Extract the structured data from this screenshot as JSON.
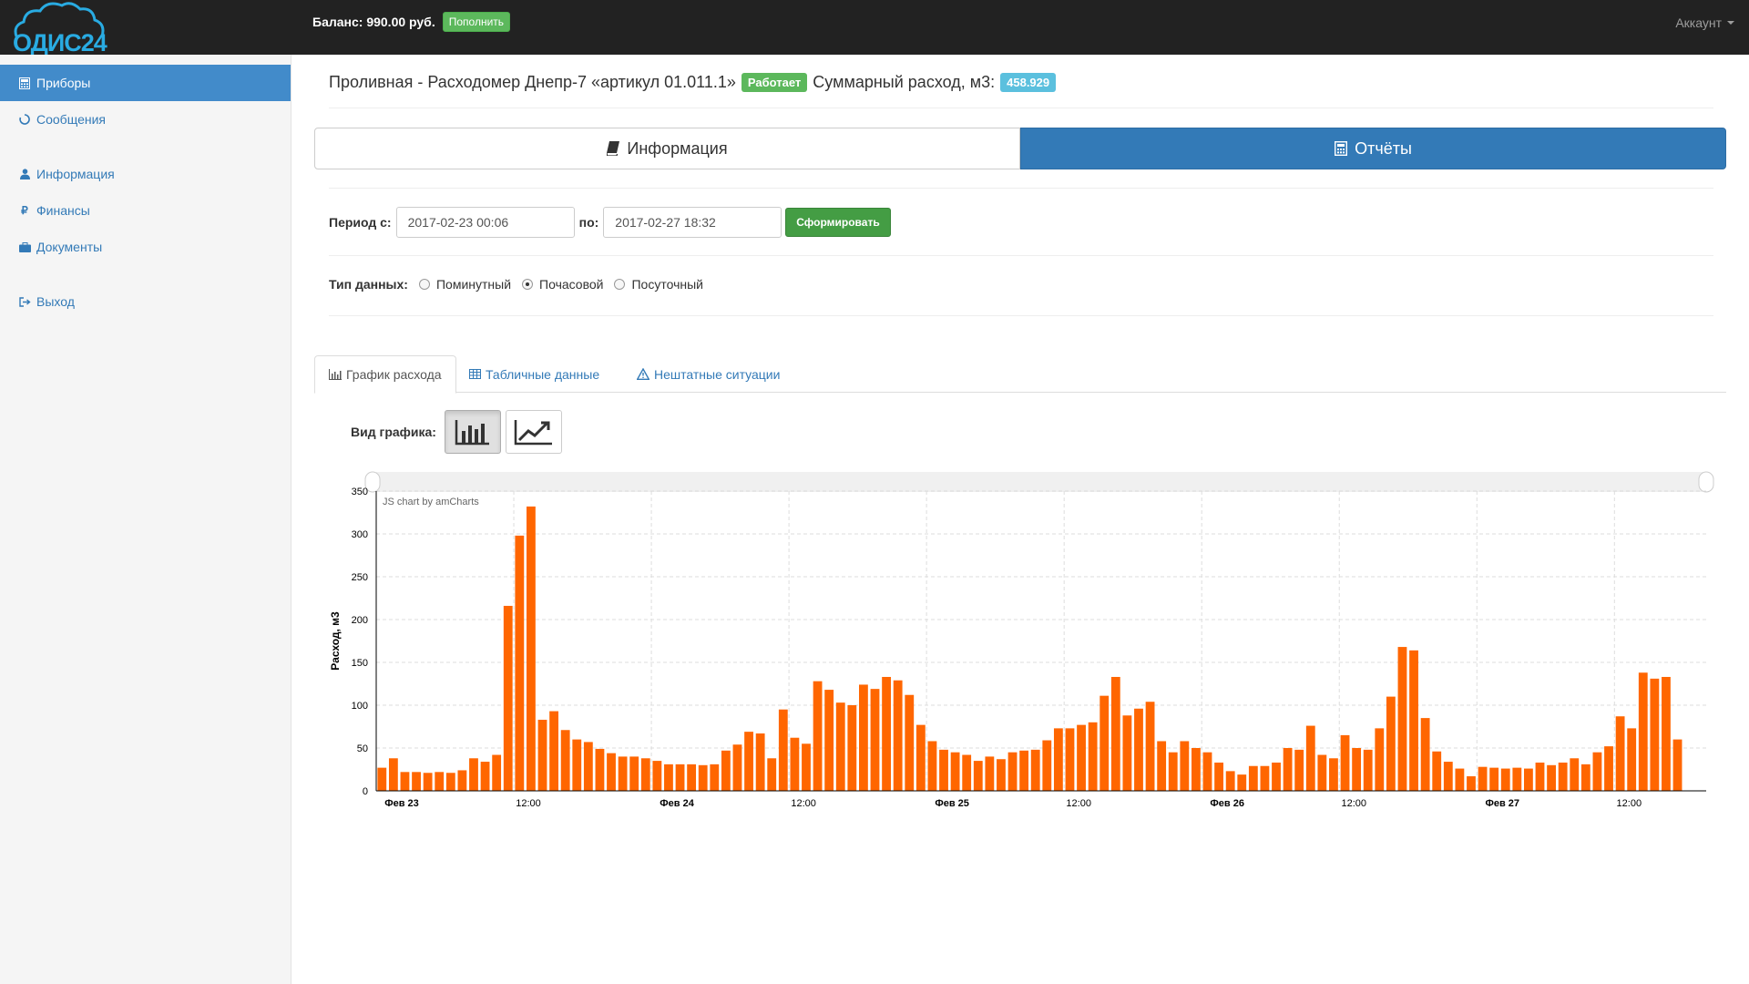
{
  "header": {
    "logo_text": "ОДИС24",
    "balance": "Баланс: 990.00 руб.",
    "topup_label": "Пополнить",
    "account_label": "Аккаунт"
  },
  "sidebar": {
    "items": [
      {
        "label": "Приборы",
        "icon": "calculator-icon",
        "active": true
      },
      {
        "label": "Сообщения",
        "icon": "spinner-icon"
      },
      {
        "label": "Информация",
        "icon": "user-icon"
      },
      {
        "label": "Финансы",
        "icon": "ruble-icon"
      },
      {
        "label": "Документы",
        "icon": "briefcase-icon"
      },
      {
        "label": "Выход",
        "icon": "sign-out-icon"
      }
    ]
  },
  "device": {
    "title": "Проливная - Расходомер Днепр-7 «артикул 01.011.1»",
    "status": "Работает",
    "total_label": "Суммарный расход, м3:",
    "total_value": "458.929"
  },
  "main_tabs": {
    "info": "Информация",
    "reports": "Отчёты"
  },
  "period": {
    "from_label": "Период с:",
    "from_value": "2017-02-23 00:06",
    "to_label": "по:",
    "to_value": "2017-02-27 18:32",
    "submit_label": "Сформировать"
  },
  "data_type": {
    "label": "Тип данных:",
    "options": [
      "Поминутный",
      "Почасовой",
      "Посуточный"
    ],
    "selected": "Почасовой"
  },
  "sub_tabs": {
    "chart": "График расхода",
    "table": "Табличные данные",
    "incidents": "Нештатные ситуации"
  },
  "chart_view": {
    "label": "Вид графика:"
  },
  "colors": {
    "accent": "#337ab7",
    "bar": "#ff6600",
    "success": "#5cb85c",
    "info": "#5bc0de"
  },
  "chart_data": {
    "type": "bar",
    "credit": "JS chart by amCharts",
    "ylabel": "Расход, м3",
    "ylim": [
      0,
      350
    ],
    "yticks": [
      0,
      50,
      100,
      150,
      200,
      250,
      300,
      350
    ],
    "x_start": "2017-02-23 00:00",
    "x_end": "2017-02-27 20:00",
    "x_step_hours": 1,
    "x_tick_labels": [
      {
        "t": "2017-02-23 00:00",
        "label": "Фев 23",
        "bold": true
      },
      {
        "t": "2017-02-23 12:00",
        "label": "12:00",
        "bold": false
      },
      {
        "t": "2017-02-24 00:00",
        "label": "Фев 24",
        "bold": true
      },
      {
        "t": "2017-02-24 12:00",
        "label": "12:00",
        "bold": false
      },
      {
        "t": "2017-02-25 00:00",
        "label": "Фев 25",
        "bold": true
      },
      {
        "t": "2017-02-25 12:00",
        "label": "12:00",
        "bold": false
      },
      {
        "t": "2017-02-26 00:00",
        "label": "Фев 26",
        "bold": true
      },
      {
        "t": "2017-02-26 12:00",
        "label": "12:00",
        "bold": false
      },
      {
        "t": "2017-02-27 00:00",
        "label": "Фев 27",
        "bold": true
      },
      {
        "t": "2017-02-27 12:00",
        "label": "12:00",
        "bold": false
      }
    ],
    "values": [
      27,
      38,
      22,
      22,
      21,
      22,
      21,
      24,
      38,
      34,
      42,
      216,
      298,
      332,
      83,
      93,
      71,
      60,
      57,
      49,
      44,
      40,
      40,
      38,
      35,
      31,
      31,
      31,
      30,
      31,
      47,
      54,
      69,
      67,
      38,
      95,
      62,
      55,
      128,
      118,
      103,
      100,
      124,
      119,
      133,
      129,
      112,
      77,
      58,
      48,
      45,
      42,
      35,
      40,
      37,
      45,
      47,
      48,
      59,
      73,
      73,
      77,
      80,
      111,
      133,
      88,
      96,
      104,
      58,
      45,
      58,
      50,
      45,
      33,
      23,
      19,
      29,
      29,
      33,
      50,
      48,
      76,
      42,
      38,
      65,
      50,
      48,
      73,
      110,
      168,
      164,
      85,
      46,
      34,
      26,
      17,
      28,
      27,
      26,
      27,
      26,
      33,
      30,
      33,
      38,
      31,
      45,
      52,
      87,
      73,
      138,
      131,
      133,
      60
    ]
  }
}
